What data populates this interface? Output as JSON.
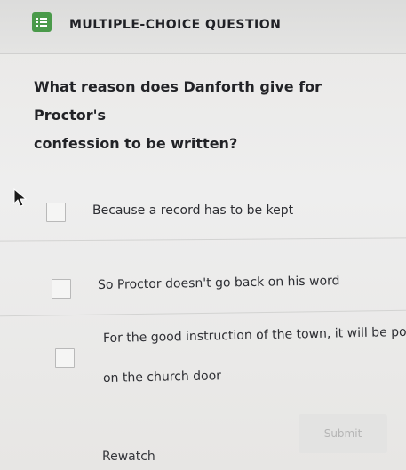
{
  "header": {
    "label": "MULTIPLE-CHOICE QUESTION",
    "icon": "list-icon",
    "icon_color": "#4a9a4a"
  },
  "question": {
    "line1": "What reason does Danforth give for Proctor's",
    "line2": "confession to be written?"
  },
  "options": [
    {
      "line1": "Because a record has to be kept",
      "line2": ""
    },
    {
      "line1": "So Proctor doesn't go back on his word",
      "line2": ""
    },
    {
      "line1": "For the good instruction of the town, it will be post",
      "line2": "on the church door"
    }
  ],
  "footer": {
    "rewatch_label": "Rewatch",
    "submit_label": "Submit"
  }
}
